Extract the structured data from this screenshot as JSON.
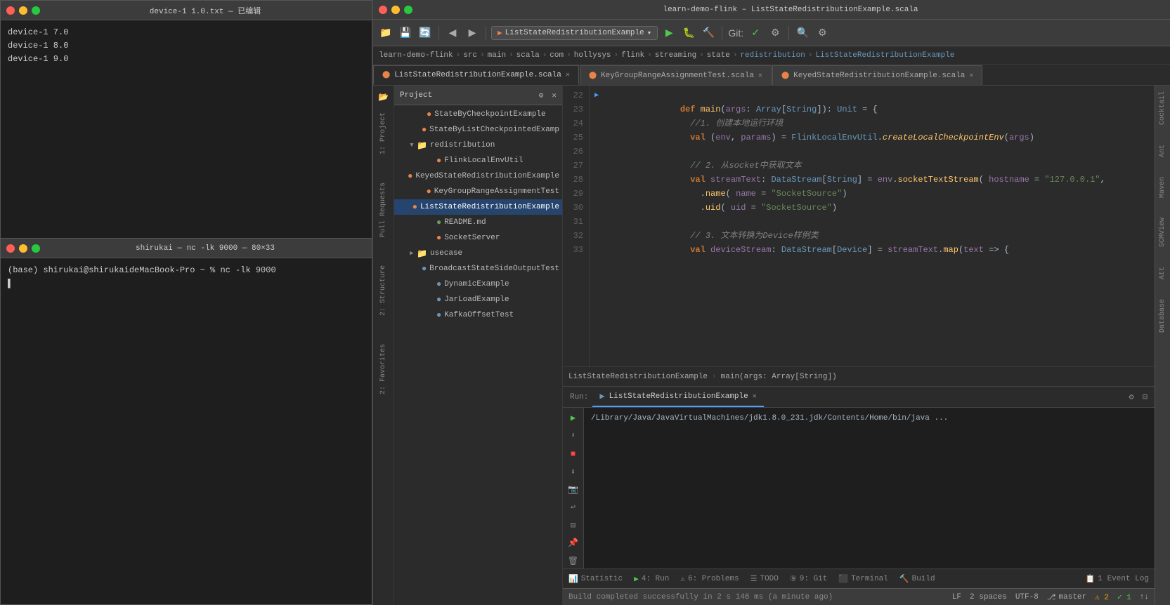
{
  "terminal_top": {
    "title": "device-1 1.0.txt — 已编辑",
    "lines": [
      "device-1 7.0",
      "device-1 8.0",
      "device-1 9.0"
    ]
  },
  "terminal_bottom": {
    "title": "shirukai — nc -lk 9000 — 80×33",
    "prompt": "(base) shirukai@shirukaideMacBook-Pro ~ % nc -lk 9000",
    "cursor": ""
  },
  "ide": {
    "title": "learn-demo-flink – ListStateRedistributionExample.scala",
    "toolbar": {
      "run_config": "ListStateRedistributionExample"
    },
    "breadcrumb": [
      "learn-demo-flink",
      "src",
      "main",
      "scala",
      "com",
      "hollysys",
      "flink",
      "streaming",
      "state",
      "redistribution",
      "ListStateRedistributionExample"
    ],
    "tabs": [
      {
        "label": "ListStateRedistributionExample.scala",
        "active": true,
        "dot_color": "#e8834a"
      },
      {
        "label": "KeyGroupRangeAssignmentTest.scala",
        "active": false,
        "dot_color": "#e8834a"
      },
      {
        "label": "KeyedStateRedistributionExample.scala",
        "active": false,
        "dot_color": "#e8834a"
      }
    ],
    "project": {
      "header": "Project",
      "items": [
        {
          "label": "StateByCheckpointExample",
          "indent": 28,
          "type": "file-orange",
          "arrow": ""
        },
        {
          "label": "StateByListCheckpointedExamp",
          "indent": 28,
          "type": "file-orange",
          "arrow": ""
        },
        {
          "label": "redistribution",
          "indent": 14,
          "type": "folder",
          "arrow": "▼",
          "expanded": true
        },
        {
          "label": "FlinkLocalEnvUtil",
          "indent": 42,
          "type": "file-orange",
          "arrow": ""
        },
        {
          "label": "KeyedStateRedistributionExample",
          "indent": 42,
          "type": "file-orange",
          "arrow": ""
        },
        {
          "label": "KeyGroupRangeAssignmentTest",
          "indent": 42,
          "type": "file-orange",
          "arrow": ""
        },
        {
          "label": "ListStateRedistributionExample",
          "indent": 42,
          "type": "file-orange",
          "arrow": "",
          "selected": true
        },
        {
          "label": "README.md",
          "indent": 42,
          "type": "file-green",
          "arrow": ""
        },
        {
          "label": "SocketServer",
          "indent": 42,
          "type": "file-orange",
          "arrow": ""
        },
        {
          "label": "usecase",
          "indent": 14,
          "type": "folder",
          "arrow": "▶",
          "expanded": false
        },
        {
          "label": "BroadcastStateSideOutputTest",
          "indent": 42,
          "type": "file-blue",
          "arrow": ""
        },
        {
          "label": "DynamicExample",
          "indent": 42,
          "type": "file-blue",
          "arrow": ""
        },
        {
          "label": "JarLoadExample",
          "indent": 42,
          "type": "file-blue",
          "arrow": ""
        },
        {
          "label": "KafkaOffsetTest",
          "indent": 42,
          "type": "file-blue",
          "arrow": ""
        }
      ]
    },
    "code": {
      "lines": [
        {
          "num": 22,
          "content": "  def main(args: Array[String]): Unit = {",
          "has_run": true
        },
        {
          "num": 23,
          "content": "    //1. 创建本地运行环境",
          "has_run": false
        },
        {
          "num": 24,
          "content": "    val (env, params) = FlinkLocalEnvUtil.createLocalCheckpointEnv(args)",
          "has_run": false
        },
        {
          "num": 25,
          "content": "",
          "has_run": false
        },
        {
          "num": 26,
          "content": "    // 2. 从socket中获取文本",
          "has_run": false
        },
        {
          "num": 27,
          "content": "    val streamText: DataStream[String] = env.socketTextStream( hostname = \"127.0.0.1\",",
          "has_run": false
        },
        {
          "num": 28,
          "content": "      .name( name = \"SocketSource\")",
          "has_run": false
        },
        {
          "num": 29,
          "content": "      .uid( uid = \"SocketSource\")",
          "has_run": false
        },
        {
          "num": 30,
          "content": "",
          "has_run": false
        },
        {
          "num": 31,
          "content": "    // 3. 文本转换为Device样例类",
          "has_run": false
        },
        {
          "num": 32,
          "content": "    val deviceStream: DataStream[Device] = streamText.map(text => {",
          "has_run": false
        },
        {
          "num": 33,
          "content": "",
          "has_run": false
        }
      ]
    },
    "run_panel": {
      "tabs": [
        {
          "label": "Run:",
          "active": false
        },
        {
          "label": "ListStateRedistributionExample",
          "active": true
        },
        {
          "label": "4: Run",
          "active": false
        },
        {
          "label": "6: Problems",
          "active": false
        },
        {
          "label": "TODO",
          "active": false
        },
        {
          "label": "9: Git",
          "active": false
        },
        {
          "label": "Terminal",
          "active": false
        },
        {
          "label": "Build",
          "active": false
        }
      ],
      "output": "/Library/Java/JavaVirtualMachines/jdk1.8.0_231.jdk/Contents/Home/bin/java ..."
    },
    "right_sidebar_labels": [
      "Cocktail",
      "Ant",
      "Maven",
      "SCMView",
      "Att",
      "Database"
    ],
    "status_bar": {
      "build_status": "Build completed successfully in 2 s 146 ms (a minute ago)",
      "lf": "LF",
      "spaces": "2 spaces",
      "encoding": "UTF-8",
      "branch": "master",
      "statistic": "Statistic",
      "event_log": "1 Event Log",
      "line_col": "2 ✓ 1"
    },
    "bottom_tabs": [
      {
        "label": "Statistic",
        "icon": "bar-chart"
      },
      {
        "label": "4: Run",
        "icon": "play"
      },
      {
        "label": "6: Problems",
        "icon": "warning"
      },
      {
        "label": "TODO",
        "icon": "list"
      },
      {
        "label": "9: Git",
        "icon": "git"
      },
      {
        "label": "Terminal",
        "icon": "terminal"
      },
      {
        "label": "Build",
        "icon": "build"
      }
    ]
  }
}
